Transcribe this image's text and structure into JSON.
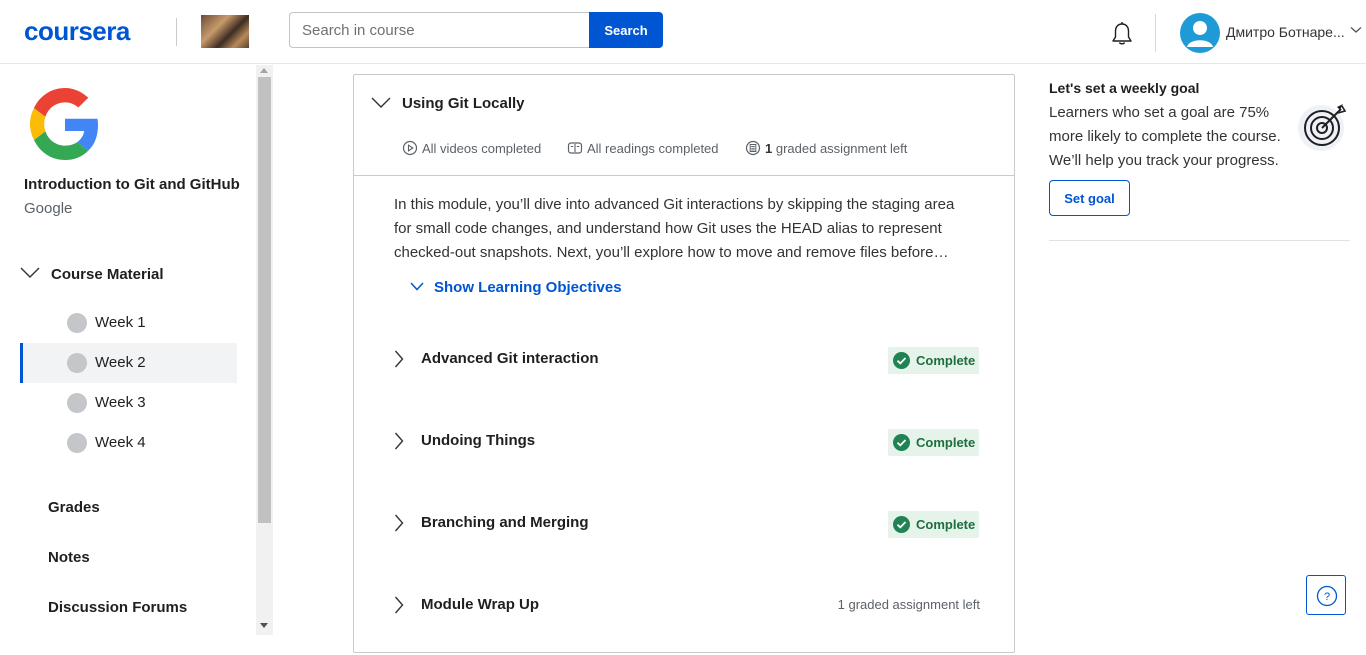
{
  "header": {
    "logo_text": "coursera",
    "search_placeholder": "Search in course",
    "search_button": "Search",
    "user_name": "Дмитро Ботнаре..."
  },
  "sidebar": {
    "course_title": "Introduction to Git and GitHub",
    "course_org": "Google",
    "section_label": "Course Material",
    "weeks": [
      {
        "label": "Week 1",
        "active": false
      },
      {
        "label": "Week 2",
        "active": true
      },
      {
        "label": "Week 3",
        "active": false
      },
      {
        "label": "Week 4",
        "active": false
      }
    ],
    "links": [
      "Grades",
      "Notes",
      "Discussion Forums"
    ]
  },
  "module": {
    "title": "Using Git Locally",
    "stats": {
      "videos": "All videos completed",
      "readings": "All readings completed",
      "graded_count": "1",
      "graded_text": "graded assignment left"
    },
    "description": "In this module, you’ll dive into advanced Git interactions by skipping the staging area for small code changes, and understand how Git uses the HEAD alias to represent checked-out snapshots. Next, you’ll explore how to move and remove files before…",
    "learning_objectives": "Show Learning Objectives",
    "lessons": [
      {
        "title": "Advanced Git interaction",
        "status": "Complete"
      },
      {
        "title": "Undoing Things",
        "status": "Complete"
      },
      {
        "title": "Branching and Merging",
        "status": "Complete"
      },
      {
        "title": "Module Wrap Up",
        "status": "1 graded assignment left"
      }
    ]
  },
  "goal": {
    "title": "Let's set a weekly goal",
    "text": "Learners who set a goal are 75% more likely to complete the course. We’ll help you track your progress.",
    "button": "Set goal"
  },
  "help": {
    "label": "?"
  },
  "colors": {
    "brand": "#0056d2",
    "complete_bg": "#e6f3ea",
    "complete_text": "#1e6e3e",
    "complete_icon": "#1f8354"
  }
}
